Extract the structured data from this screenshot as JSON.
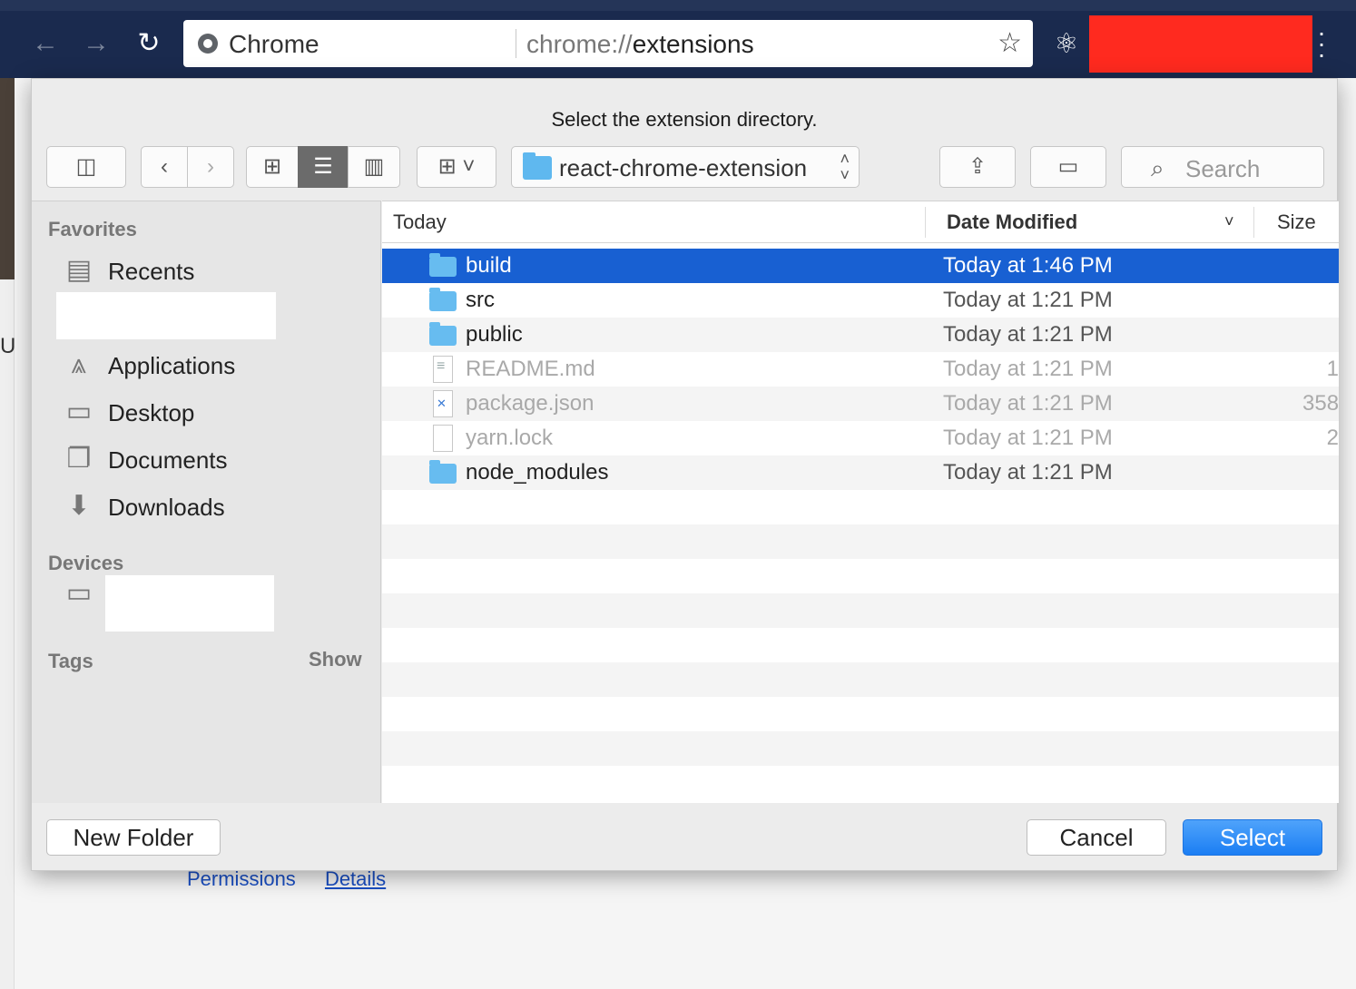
{
  "browser": {
    "omnibox_label": "Chrome",
    "url_scheme": "chrome://",
    "url_path": "extensions"
  },
  "page": {
    "left_char": "U",
    "links": [
      "Permissions",
      "Details"
    ]
  },
  "dialog": {
    "title": "Select the extension directory.",
    "path_popup": "react-chrome-extension",
    "search_placeholder": "Search",
    "sidebar": {
      "favorites_heading": "Favorites",
      "favorites": [
        "Recents",
        "Applications",
        "Desktop",
        "Documents",
        "Downloads"
      ],
      "devices_heading": "Devices",
      "tags_heading": "Tags",
      "tags_show": "Show"
    },
    "columns": {
      "name": "Today",
      "date": "Date Modified",
      "size": "Size"
    },
    "files": [
      {
        "name": "build",
        "date": "Today at 1:46 PM",
        "size": "",
        "kind": "folder",
        "state": "selected"
      },
      {
        "name": "src",
        "date": "Today at 1:21 PM",
        "size": "",
        "kind": "folder",
        "state": "normal"
      },
      {
        "name": "public",
        "date": "Today at 1:21 PM",
        "size": "",
        "kind": "folder",
        "state": "normal"
      },
      {
        "name": "README.md",
        "date": "Today at 1:21 PM",
        "size": "1",
        "kind": "file-md",
        "state": "disabled"
      },
      {
        "name": "package.json",
        "date": "Today at 1:21 PM",
        "size": "358",
        "kind": "file-js",
        "state": "disabled"
      },
      {
        "name": "yarn.lock",
        "date": "Today at 1:21 PM",
        "size": "2",
        "kind": "file",
        "state": "disabled"
      },
      {
        "name": "node_modules",
        "date": "Today at 1:21 PM",
        "size": "",
        "kind": "folder",
        "state": "normal"
      }
    ],
    "buttons": {
      "new_folder": "New Folder",
      "cancel": "Cancel",
      "select": "Select"
    }
  },
  "colors": {
    "selection": "#1860d2",
    "primary_button": "#1b7ef3",
    "redaction": "#ff2a1f",
    "toolbar": "#1a2a4e"
  }
}
